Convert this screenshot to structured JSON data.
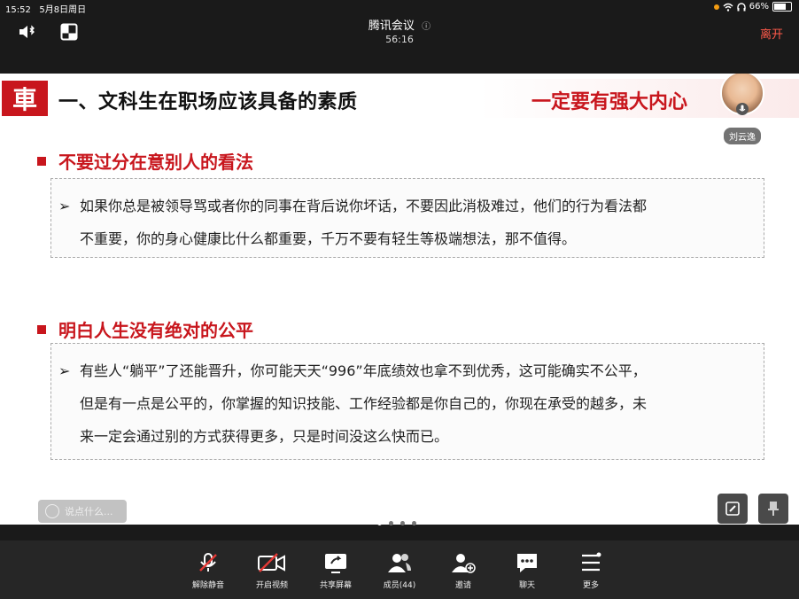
{
  "status": {
    "time": "15:52",
    "date": "5月8日周日",
    "battery": "66%"
  },
  "meeting": {
    "title": "腾讯会议",
    "timer": "56:16",
    "leave_label": "离开"
  },
  "slide": {
    "logo_text": "車",
    "title": "一、文科生在职场应该具备的素质",
    "slogan": "一定要有强大内心",
    "participant_name": "刘云逸",
    "sections": [
      {
        "heading": "不要过分在意别人的看法",
        "bullet": "➢",
        "lines": [
          "如果你总是被领导骂或者你的同事在背后说你坏话，不要因此消极难过，他们的行为看法都",
          "不重要，你的身心健康比什么都重要，千万不要有轻生等极端想法，那不值得。"
        ]
      },
      {
        "heading": "明白人生没有绝对的公平",
        "bullet": "➢",
        "lines": [
          "有些人“躺平”了还能晋升，你可能天天“996”年底绩效也拿不到优秀，这可能确实不公平，",
          "但是有一点是公平的，你掌握的知识技能、工作经验都是你自己的，你现在承受的越多，未",
          "来一定会通过别的方式获得更多，只是时间没这么快而已。"
        ]
      }
    ]
  },
  "chat": {
    "placeholder": "说点什么..."
  },
  "toolbar": [
    {
      "label": "解除静音",
      "icon": "mic-muted-icon"
    },
    {
      "label": "开启视频",
      "icon": "camera-off-icon"
    },
    {
      "label": "共享屏幕",
      "icon": "share-screen-icon"
    },
    {
      "label": "成员(44)",
      "icon": "members-icon"
    },
    {
      "label": "邀请",
      "icon": "invite-icon"
    },
    {
      "label": "聊天",
      "icon": "chat-icon"
    },
    {
      "label": "更多",
      "icon": "more-icon"
    }
  ],
  "colors": {
    "accent": "#c8161d",
    "leave": "#ff5a4a"
  }
}
